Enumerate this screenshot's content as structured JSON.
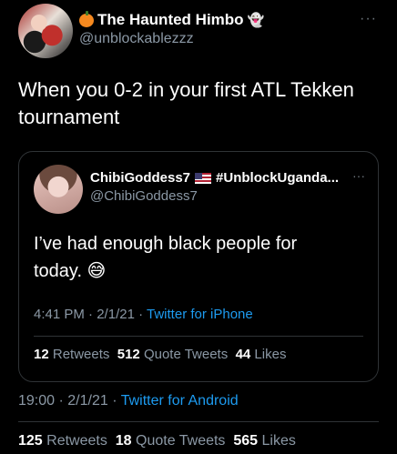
{
  "author": {
    "name": "The Haunted Himbo",
    "handle": "@unblockablezzz",
    "prefix_icon": "pumpkin-icon",
    "suffix_emoji": "👻"
  },
  "more_label": "···",
  "tweet": {
    "text": "When you 0-2 in your first ATL Tekken tournament",
    "time": "19:00",
    "date": "2/1/21",
    "source": "Twitter for Android",
    "retweets": "125",
    "retweets_label": "Retweets",
    "quotes": "18",
    "quotes_label": "Quote Tweets",
    "likes": "565",
    "likes_label": "Likes"
  },
  "quoted": {
    "name": "ChibiGoddess7",
    "flag_icon": "us-flag-icon",
    "hashtag": "#UnblockUganda...",
    "handle": "@ChibiGoddess7",
    "text": "I’ve had enough black people for today. 😅",
    "time": "4:41 PM",
    "date": "2/1/21",
    "source": "Twitter for iPhone",
    "retweets": "12",
    "retweets_label": "Retweets",
    "quotes": "512",
    "quotes_label": "Quote Tweets",
    "likes": "44",
    "likes_label": "Likes"
  },
  "separator": "·"
}
